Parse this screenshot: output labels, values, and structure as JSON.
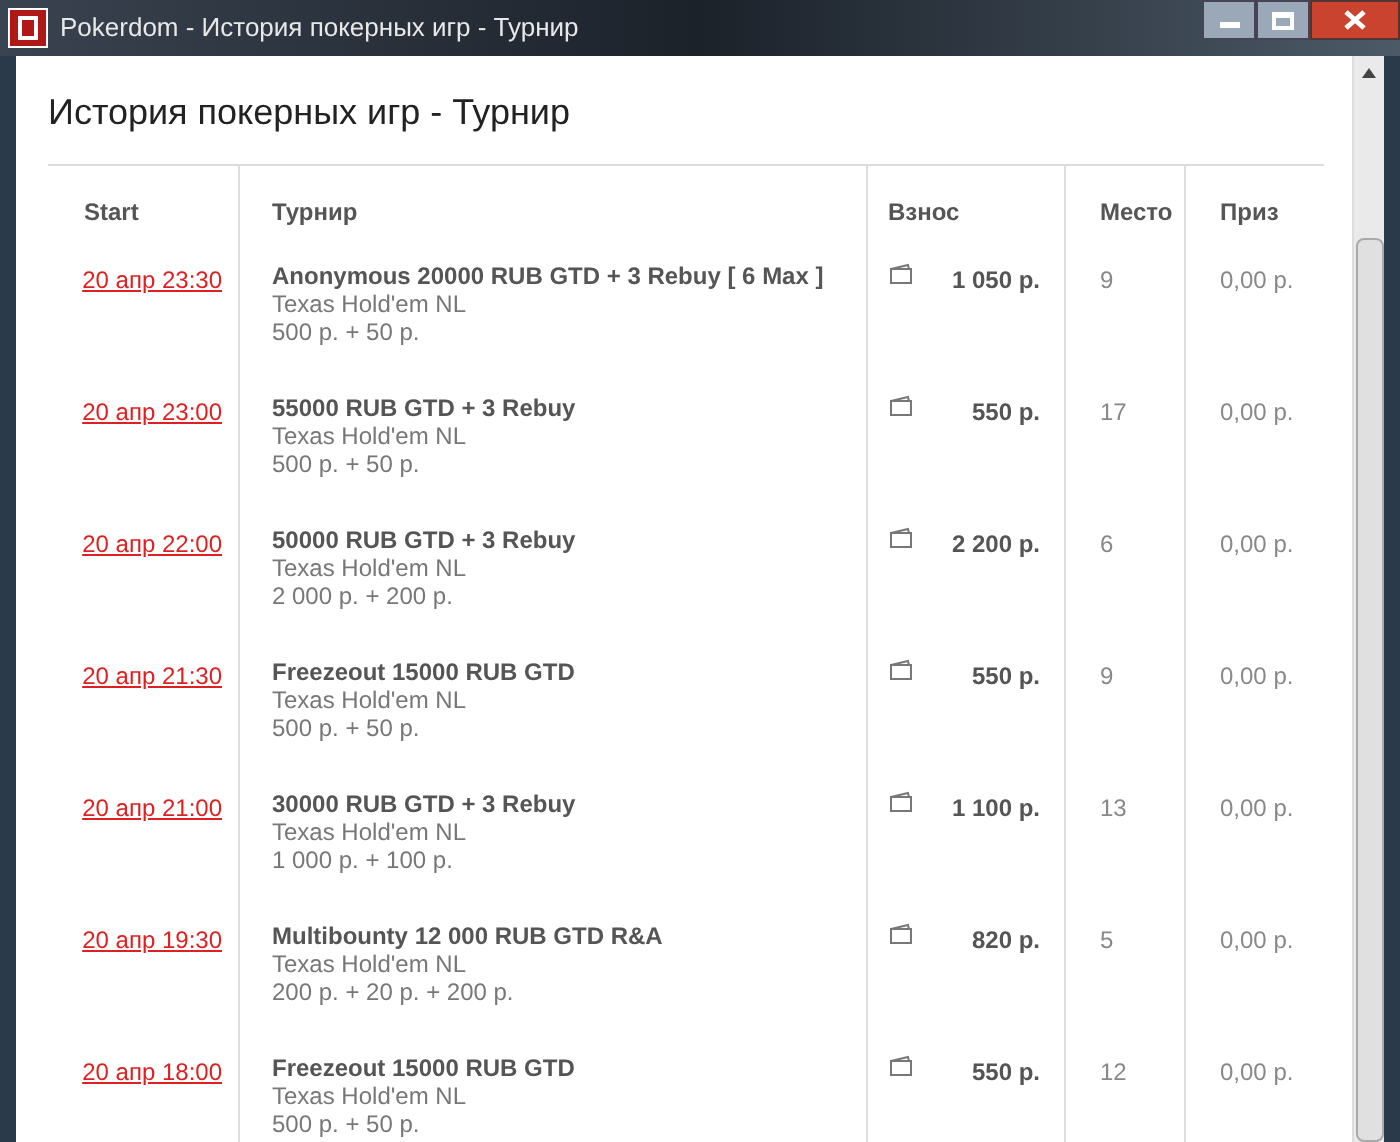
{
  "window": {
    "title": "Pokerdom - История покерных игр - Турнир"
  },
  "page_title": "История покерных игр - Турнир",
  "table": {
    "columns": [
      "Start",
      "Турнир",
      "Взнос",
      "Место",
      "Приз"
    ],
    "rows": [
      {
        "start": "20 апр 23:30",
        "name": "Anonymous 20000 RUB GTD + 3 Rebuy [ 6 Max ]",
        "game": "Texas Hold'em NL",
        "buyin_detail": "500 р. + 50 р.",
        "fee": "1 050 р.",
        "place": "9",
        "prize": "0,00 р."
      },
      {
        "start": "20 апр 23:00",
        "name": "55000 RUB GTD + 3 Rebuy",
        "game": "Texas Hold'em NL",
        "buyin_detail": "500 р. + 50 р.",
        "fee": "550 р.",
        "place": "17",
        "prize": "0,00 р."
      },
      {
        "start": "20 апр 22:00",
        "name": "50000 RUB GTD + 3 Rebuy",
        "game": "Texas Hold'em NL",
        "buyin_detail": "2 000 р. + 200 р.",
        "fee": "2 200 р.",
        "place": "6",
        "prize": "0,00 р."
      },
      {
        "start": "20 апр 21:30",
        "name": "Freezeout 15000 RUB GTD",
        "game": "Texas Hold'em NL",
        "buyin_detail": "500 р. + 50 р.",
        "fee": "550 р.",
        "place": "9",
        "prize": "0,00 р."
      },
      {
        "start": "20 апр 21:00",
        "name": "30000 RUB GTD + 3 Rebuy",
        "game": "Texas Hold'em NL",
        "buyin_detail": "1 000 р. + 100 р.",
        "fee": "1 100 р.",
        "place": "13",
        "prize": "0,00 р."
      },
      {
        "start": "20 апр 19:30",
        "name": "Multibounty 12 000 RUB GTD R&A",
        "game": "Texas Hold'em NL",
        "buyin_detail": "200 р. + 20 р. + 200 р.",
        "fee": "820 р.",
        "place": "5",
        "prize": "0,00 р."
      },
      {
        "start": "20 апр 18:00",
        "name": "Freezeout 15000 RUB GTD",
        "game": "Texas Hold'em NL",
        "buyin_detail": "500 р. + 50 р.",
        "fee": "550 р.",
        "place": "12",
        "prize": "0,00 р."
      }
    ]
  }
}
